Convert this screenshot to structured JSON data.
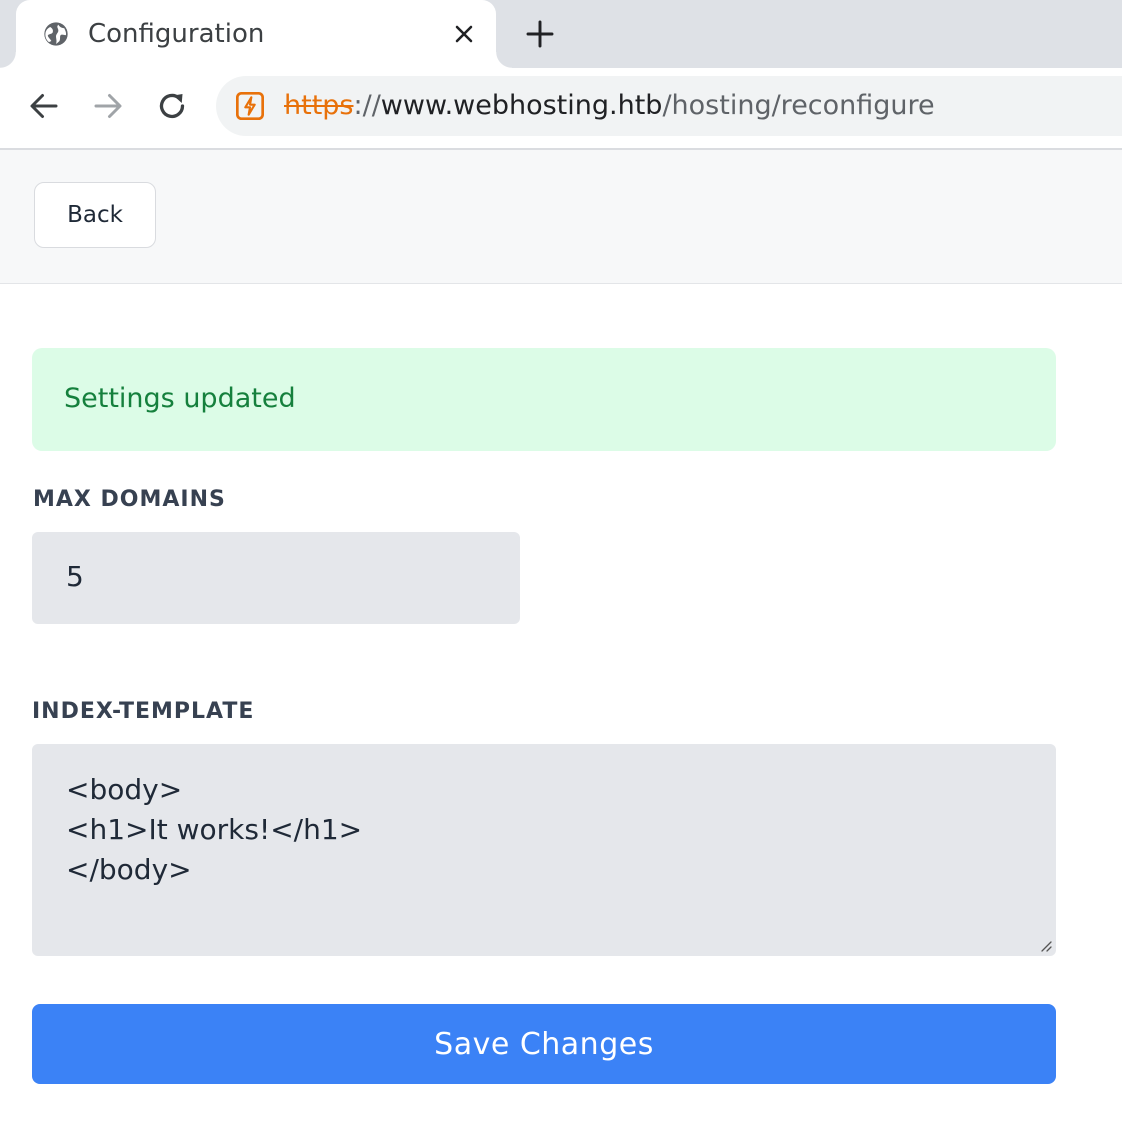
{
  "browser": {
    "tab": {
      "title": "Configuration",
      "icon": "globe-icon"
    },
    "new_tab_icon": "plus-icon",
    "url": {
      "scheme": "https",
      "separator": "://",
      "host": "www.webhosting.htb",
      "path": "/hosting/reconfigure",
      "security_icon": "not-secure-icon"
    }
  },
  "header": {
    "back_label": "Back"
  },
  "alert": {
    "message": "Settings updated",
    "color": "#15803d",
    "background": "#dcfce7"
  },
  "form": {
    "max_domains": {
      "label": "MAX DOMAINS",
      "value": "5"
    },
    "index_template": {
      "label": "INDEX-TEMPLATE",
      "value": "<body>\n<h1>It works!</h1>\n</body>"
    },
    "save_label": "Save Changes",
    "accent": "#3b82f6"
  }
}
